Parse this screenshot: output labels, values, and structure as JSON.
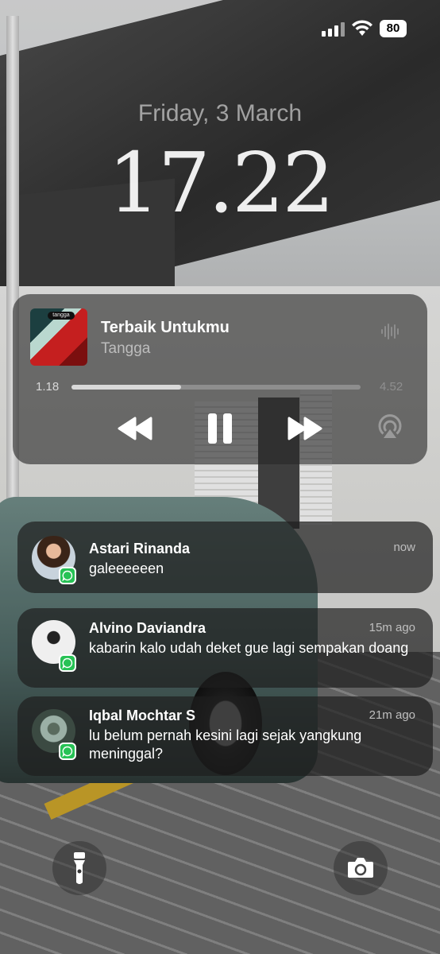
{
  "status_bar": {
    "battery": "80"
  },
  "lock_screen": {
    "date": "Friday, 3 March",
    "time": "17.22"
  },
  "now_playing": {
    "art_tag": "tangga",
    "title": "Terbaik Untukmu",
    "artist": "Tangga",
    "elapsed": "1.18",
    "remaining": "4.52",
    "progress": 0.38
  },
  "notifications": [
    {
      "name": "Astari Rinanda",
      "time": "now",
      "message": "galeeeeeen",
      "app_icon": "whatsapp-icon"
    },
    {
      "name": "Alvino Daviandra",
      "time": "15m ago",
      "message": "kabarin kalo udah deket gue lagi sempakan doang",
      "app_icon": "whatsapp-icon"
    },
    {
      "name": "Iqbal Mochtar S",
      "time": "21m ago",
      "message": "lu belum pernah kesini lagi sejak yangkung meninggal?",
      "app_icon": "whatsapp-icon"
    }
  ],
  "quick_actions": {
    "left": "flashlight-icon",
    "right": "camera-icon"
  },
  "colors": {
    "whatsapp": "#27c255",
    "panel": "#282828"
  }
}
